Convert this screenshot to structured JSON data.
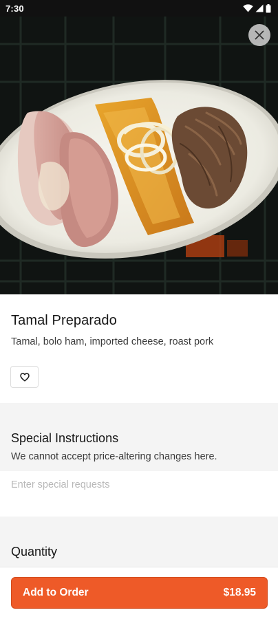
{
  "status_bar": {
    "time": "7:30",
    "icons": [
      "wifi-icon",
      "cell-signal-icon",
      "battery-icon"
    ]
  },
  "hero": {
    "image": "plate-photo",
    "close_icon": "close-icon"
  },
  "item": {
    "title": "Tamal Preparado",
    "description": "Tamal, bolo ham, imported cheese, roast pork",
    "favorite_icon": "heart-outline-icon"
  },
  "special_instructions": {
    "title": "Special Instructions",
    "subtitle": "We cannot accept price-altering changes here.",
    "placeholder": "Enter special requests",
    "value": ""
  },
  "quantity": {
    "title": "Quantity"
  },
  "order_button": {
    "label": "Add to Order",
    "price": "$18.95"
  },
  "colors": {
    "accent": "#ee5a28",
    "section_bg": "#f4f4f4",
    "status_bar": "#111111"
  }
}
